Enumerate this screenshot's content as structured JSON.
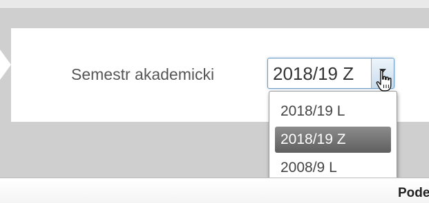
{
  "form": {
    "label": "Semestr akademicki",
    "selected_value": "2018/19 Z",
    "options": [
      {
        "label": "2018/19 L",
        "highlighted": false
      },
      {
        "label": "2018/19 Z",
        "highlighted": true
      },
      {
        "label": "2008/9 L",
        "highlighted": false
      }
    ],
    "arrow_icon": "triangle-down-icon"
  },
  "cursor": {
    "icon": "hand-pointer-icon"
  },
  "footer": {
    "text": "Pode"
  },
  "colors": {
    "highlight": "#7a7a7a",
    "select_border": "#6f9cc4",
    "panel_bg": "#ffffff",
    "page_bg": "#cfcfcf"
  }
}
